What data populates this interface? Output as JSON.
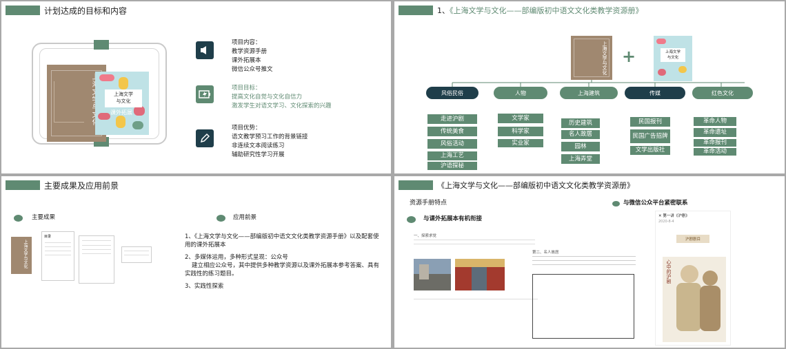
{
  "p1": {
    "title": "计划达成的目标和内容",
    "book_title_a": "上海文学与文化",
    "book_title_b_line1": "上海文学",
    "book_title_b_line2": "与文化",
    "book_b_subtitle": "课外拓展",
    "items": [
      {
        "icon": "speaker-icon",
        "heading": "项目内容：",
        "lines": [
          "教学资源手册",
          "课外拓展本",
          "微信公众号推文"
        ]
      },
      {
        "icon": "battery-icon",
        "heading": "项目目标：",
        "lines": [
          "提高文化自觉与文化自信力",
          "激发学生对语文学习、文化探索的兴趣"
        ]
      },
      {
        "icon": "pencil-icon",
        "heading": "项目优势：",
        "lines": [
          "语文教学预习工作的背景链接",
          "非连续文本阅读练习",
          "辅助研究性学习开展"
        ]
      }
    ]
  },
  "p2": {
    "number": "1、",
    "title": "《上海文学与文化——部编版初中语文文化类教学资源册》",
    "plus": "+",
    "book_a": "上海文学与文化",
    "book_b_line1": "上海文学",
    "book_b_line2": "与文化",
    "categories": [
      {
        "label": "风俗民俗",
        "items": [
          "走进沪剧",
          "传统美食",
          "风俗活动",
          "上海工艺",
          "沪语探秘"
        ]
      },
      {
        "label": "人物",
        "items": [
          "文学家",
          "科学家",
          "实业家"
        ]
      },
      {
        "label": "上海建筑",
        "items": [
          "历史建筑",
          "名人故居",
          "园林",
          "上海弄堂"
        ]
      },
      {
        "label": "传媒",
        "items": [
          "民国报刊",
          "民国广告招牌",
          "文学出版社"
        ]
      },
      {
        "label": "红色文化",
        "items": [
          "革命人物",
          "革命遗址",
          "革命报刊",
          "革命活动"
        ]
      }
    ]
  },
  "p3": {
    "title": "主要成果及应用前景",
    "left_heading": "主要成果",
    "right_heading": "应用前景",
    "book_title": "上海文学与文化",
    "toc_title": "目录",
    "points": [
      "1、《上海文学与文化——部编版初中语文文化类教学资源手册》以及配套使用的课外拓展本",
      "2、多媒体运用，多种形式呈现：公众号",
      "建立相应公众号，其中提供多种教学资源以及课外拓展本参考答案、具有实践性的练习题目。",
      "3、实践性探索"
    ]
  },
  "p4": {
    "title": "《上海文学与文化——部编版初中语文文化类教学资源册》",
    "subtitle": "资源手册特点",
    "left_heading": "与课外拓展本有机衔接",
    "right_heading": "与微信公众平台紧密联系",
    "wechat_header": "第一讲《沪剧》",
    "wechat_date": "2020-8-4",
    "wechat_banner": "沪剧剧目",
    "poster_text": "心中的沪剧",
    "doc_section": "一、探索求觉",
    "doc_section2": "第二、名人故居"
  }
}
